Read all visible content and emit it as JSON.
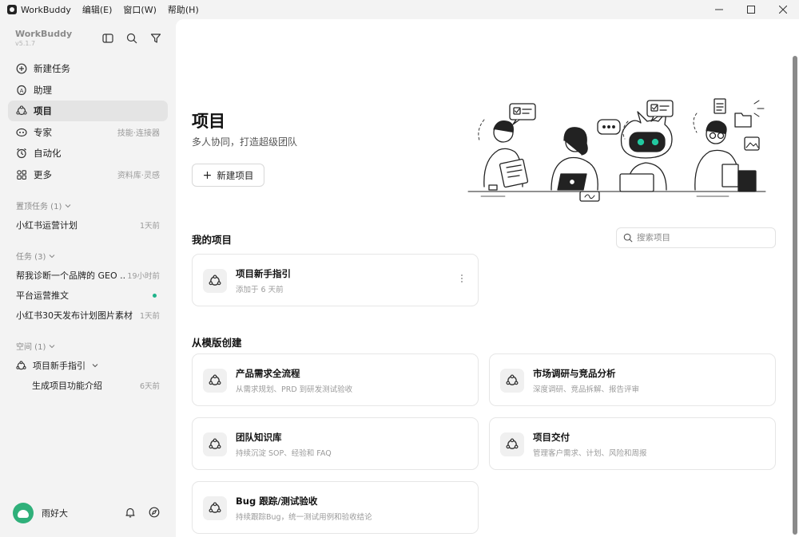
{
  "titlebar": {
    "app_name": "WorkBuddy",
    "menus": [
      "编辑(E)",
      "窗口(W)",
      "帮助(H)"
    ]
  },
  "sidebar": {
    "brand": "WorkBuddy",
    "version": "v5.1.7",
    "nav": [
      {
        "label": "新建任务",
        "icon": "plus-circle-icon",
        "hint": ""
      },
      {
        "label": "助理",
        "icon": "assistant-icon",
        "hint": ""
      },
      {
        "label": "项目",
        "icon": "project-icon",
        "hint": ""
      },
      {
        "label": "专家",
        "icon": "expert-icon",
        "hint": "技能·连接器"
      },
      {
        "label": "自动化",
        "icon": "alarm-clock-icon",
        "hint": ""
      },
      {
        "label": "更多",
        "icon": "grid-icon",
        "hint": "资料库·灵感"
      }
    ],
    "pinned": {
      "header": "置顶任务 (1)",
      "items": [
        {
          "name": "小红书运营计划",
          "time": "1天前"
        }
      ]
    },
    "tasks": {
      "header": "任务 (3)",
      "items": [
        {
          "name": "帮我诊断一个品牌的 GEO ...",
          "time": "19小时前"
        },
        {
          "name": "平台运营推文",
          "time": ""
        },
        {
          "name": "小红书30天发布计划图片素材",
          "time": "1天前"
        }
      ]
    },
    "spaces": {
      "header": "空间 (1)",
      "project": "项目新手指引",
      "sub_items": [
        {
          "name": "生成项目功能介绍",
          "time": "6天前"
        }
      ]
    },
    "user": {
      "name": "雨好大"
    }
  },
  "main": {
    "title": "项目",
    "subtitle": "多人协同，打造超级团队",
    "new_project_label": "新建项目",
    "my_projects": {
      "title": "我的项目",
      "search_placeholder": "搜索项目",
      "items": [
        {
          "title": "项目新手指引",
          "desc": "添加于 6 天前"
        }
      ]
    },
    "templates": {
      "title": "从模版创建",
      "items": [
        {
          "title": "产品需求全流程",
          "desc": "从需求规划、PRD 到研发测试验收"
        },
        {
          "title": "市场调研与竞品分析",
          "desc": "深度调研、竞品拆解、报告评审"
        },
        {
          "title": "团队知识库",
          "desc": "持续沉淀 SOP、经验和 FAQ"
        },
        {
          "title": "项目交付",
          "desc": "管理客户需求、计划、风险和周报"
        },
        {
          "title": "Bug 跟踪/测试验收",
          "desc": "持续跟踪Bug，统一测试用例和验收结论"
        }
      ]
    }
  },
  "colors": {
    "accent_green": "#1fb38a",
    "avatar_green": "#2fb07a",
    "robot_eyes": "#22c9a0"
  }
}
